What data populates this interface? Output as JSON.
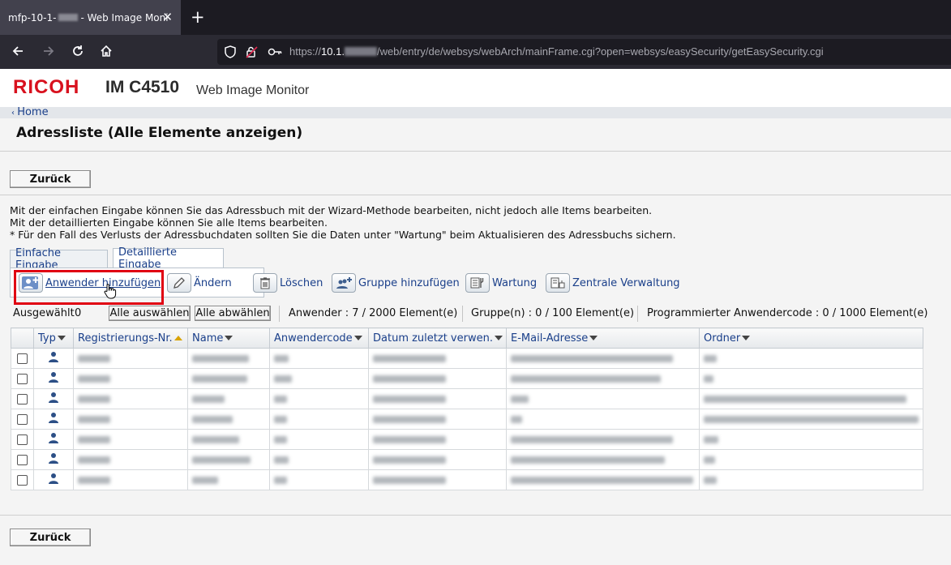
{
  "browser": {
    "tab_title_prefix": "mfp-10-1-",
    "tab_title_suffix": "- Web Image Moni",
    "url_prefix": "https://",
    "url_host": "10.1.",
    "url_path": "/web/entry/de/websys/webArch/mainFrame.cgi?open=websys/easySecurity/getEasySecurity.cgi"
  },
  "brand": {
    "logo": "RICOH",
    "model": "IM C4510",
    "product": "Web Image Monitor"
  },
  "nav": {
    "home_link": "Home"
  },
  "page": {
    "title": "Adressliste (Alle Elemente anzeigen)",
    "back_button": "Zurück"
  },
  "description": [
    "Mit der einfachen Eingabe können Sie das Adressbuch mit der Wizard-Methode bearbeiten, nicht jedoch alle Items bearbeiten.",
    "Mit der detaillierten Eingabe können Sie alle Items bearbeiten.",
    "* Für den Fall des Verlusts der Adressbuchdaten sollten Sie die Daten unter \"Wartung\" beim Aktualisieren des Adressbuchs sichern."
  ],
  "tabs": {
    "simple": "Einfache Eingabe",
    "detailed": "Detaillierte Eingabe"
  },
  "toolbar": {
    "add_user": "Anwender hinzufügen",
    "change": "Ändern",
    "delete": "Löschen",
    "add_group": "Gruppe hinzufügen",
    "maintenance": "Wartung",
    "central_admin": "Zentrale Verwaltung"
  },
  "selection": {
    "selected_label": "Ausgewählt",
    "selected_count": "0",
    "select_all": "Alle auswählen",
    "deselect_all": "Alle abwählen",
    "users": "Anwender : 7 / 2000 Element(e)",
    "groups": "Gruppe(n) : 0 / 100 Element(e)",
    "programmed_codes": "Programmierter Anwendercode : 0 / 1000 Element(e)"
  },
  "table": {
    "columns": [
      "Typ",
      "Registrierungs-Nr.",
      "Name",
      "Anwendercode",
      "Datum zuletzt verwen.",
      "E-Mail-Adresse",
      "Ordner"
    ],
    "sorted_column": "Registrierungs-Nr.",
    "row_type_icon": "user-icon",
    "row_count": 7
  },
  "colors": {
    "accent_red": "#e00012",
    "link_blue": "#1a3f8a",
    "brand_red": "#d8111e"
  }
}
